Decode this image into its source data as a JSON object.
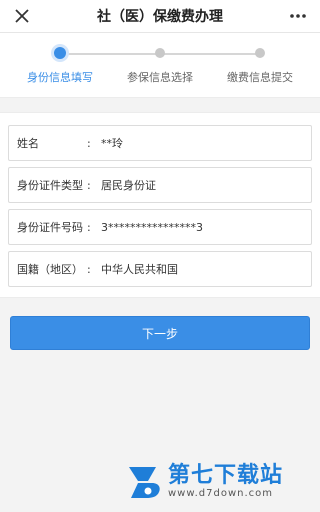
{
  "window": {
    "title": "社（医）保缴费办理",
    "close_icon": "close-icon",
    "more_icon": "more-icon"
  },
  "steps": [
    {
      "label": "身份信息填写",
      "active": true
    },
    {
      "label": "参保信息选择",
      "active": false
    },
    {
      "label": "缴费信息提交",
      "active": false
    }
  ],
  "form": {
    "fields": [
      {
        "label": "姓名",
        "value": "**玲"
      },
      {
        "label": "身份证件类型",
        "value": "居民身份证"
      },
      {
        "label": "身份证件号码",
        "value": "3****************3"
      },
      {
        "label": "国籍（地区）",
        "value": "中华人民共和国"
      }
    ]
  },
  "next_button": {
    "label": "下一步"
  },
  "colors": {
    "accent": "#3a8ee6",
    "background": "#f3f3f3"
  },
  "watermark": {
    "text_cn": "第七下载站",
    "url": "www.d7down.com"
  }
}
